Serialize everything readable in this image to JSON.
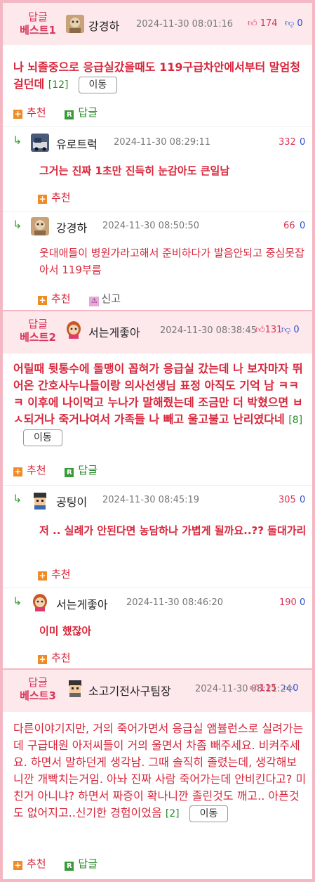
{
  "labels": {
    "recommend": "추천",
    "reply": "답글",
    "move": "이동",
    "report": "신고"
  },
  "best": [
    {
      "rank": [
        "답글",
        "베스트1"
      ],
      "nick": "강경하",
      "date": "2024-11-30 08:01:16",
      "up": "174",
      "down": "0",
      "text": "나 뇌졸중으로 응급실갔을때도 119구급차안에서부터 말엄청걸던데",
      "count": "[12]",
      "replies": [
        {
          "nick": "유로트럭",
          "date": "2024-11-30 08:29:11",
          "up": "332",
          "down": "0",
          "text": "그거는 진짜 1초만 진득히 눈감아도 큰일남",
          "report": false
        },
        {
          "nick": "강경하",
          "date": "2024-11-30 08:50:50",
          "up": "66",
          "down": "0",
          "text": "웃대애들이 병원가라고해서 준비하다가 발음안되고 중심못잡아서 119부름",
          "report": true
        }
      ]
    },
    {
      "rank": [
        "답글",
        "베스트2"
      ],
      "nick": "서는게좋아",
      "date": "2024-11-30 08:38:45",
      "up": "131",
      "down": "0",
      "text": "어릴때 뒷통수에 돌맹이 꼽혀가 응급실 갔는데 나 보자마자 뛰어온 간호사누나들이랑 의사선생님 표정 아직도 기억 남 ㅋㅋㅋ 이후에 나이먹고 누나가 말해줬는데 조금만 더 박혔으면 ㅂㅅ되거나 죽거나여서 가족들 나 빼고 울고불고 난리였다네",
      "count": "[8]",
      "replies": [
        {
          "nick": "공팅이",
          "date": "2024-11-30 08:45:19",
          "up": "305",
          "down": "0",
          "text": "저 .. 실례가 안된다면 농담하나 가볍게 될까요..?? 돌대가리",
          "report": false
        },
        {
          "nick": "서는게좋아",
          "date": "2024-11-30 08:46:20",
          "up": "190",
          "down": "0",
          "text": "이미 했잖아",
          "report": false
        }
      ]
    },
    {
      "rank": [
        "답글",
        "베스트3"
      ],
      "nick": "소고기전사구팀장",
      "date": "2024-11-30 08:21:24",
      "up": "115",
      "down": "0",
      "text": "다른이야기지만, 거의 죽어가면서 응급실 앰뷸런스로 실려가는데 구급대원 아저씨들이 거의 울면서 차좀 빼주세요. 비켜주세요. 하면서 말하던게 생각남. 그때 솔직히 졸렸는데, 생각해보니깐 개빡치는거임. 아놔 진짜 사람 죽어가는데 안비킨다고? 미친거 아니냐? 하면서 짜증이 확나니깐 졸린것도 깨고.. 아픈것도 없어지고..신기한 경험이었음",
      "count": "[2]",
      "replies": []
    }
  ]
}
